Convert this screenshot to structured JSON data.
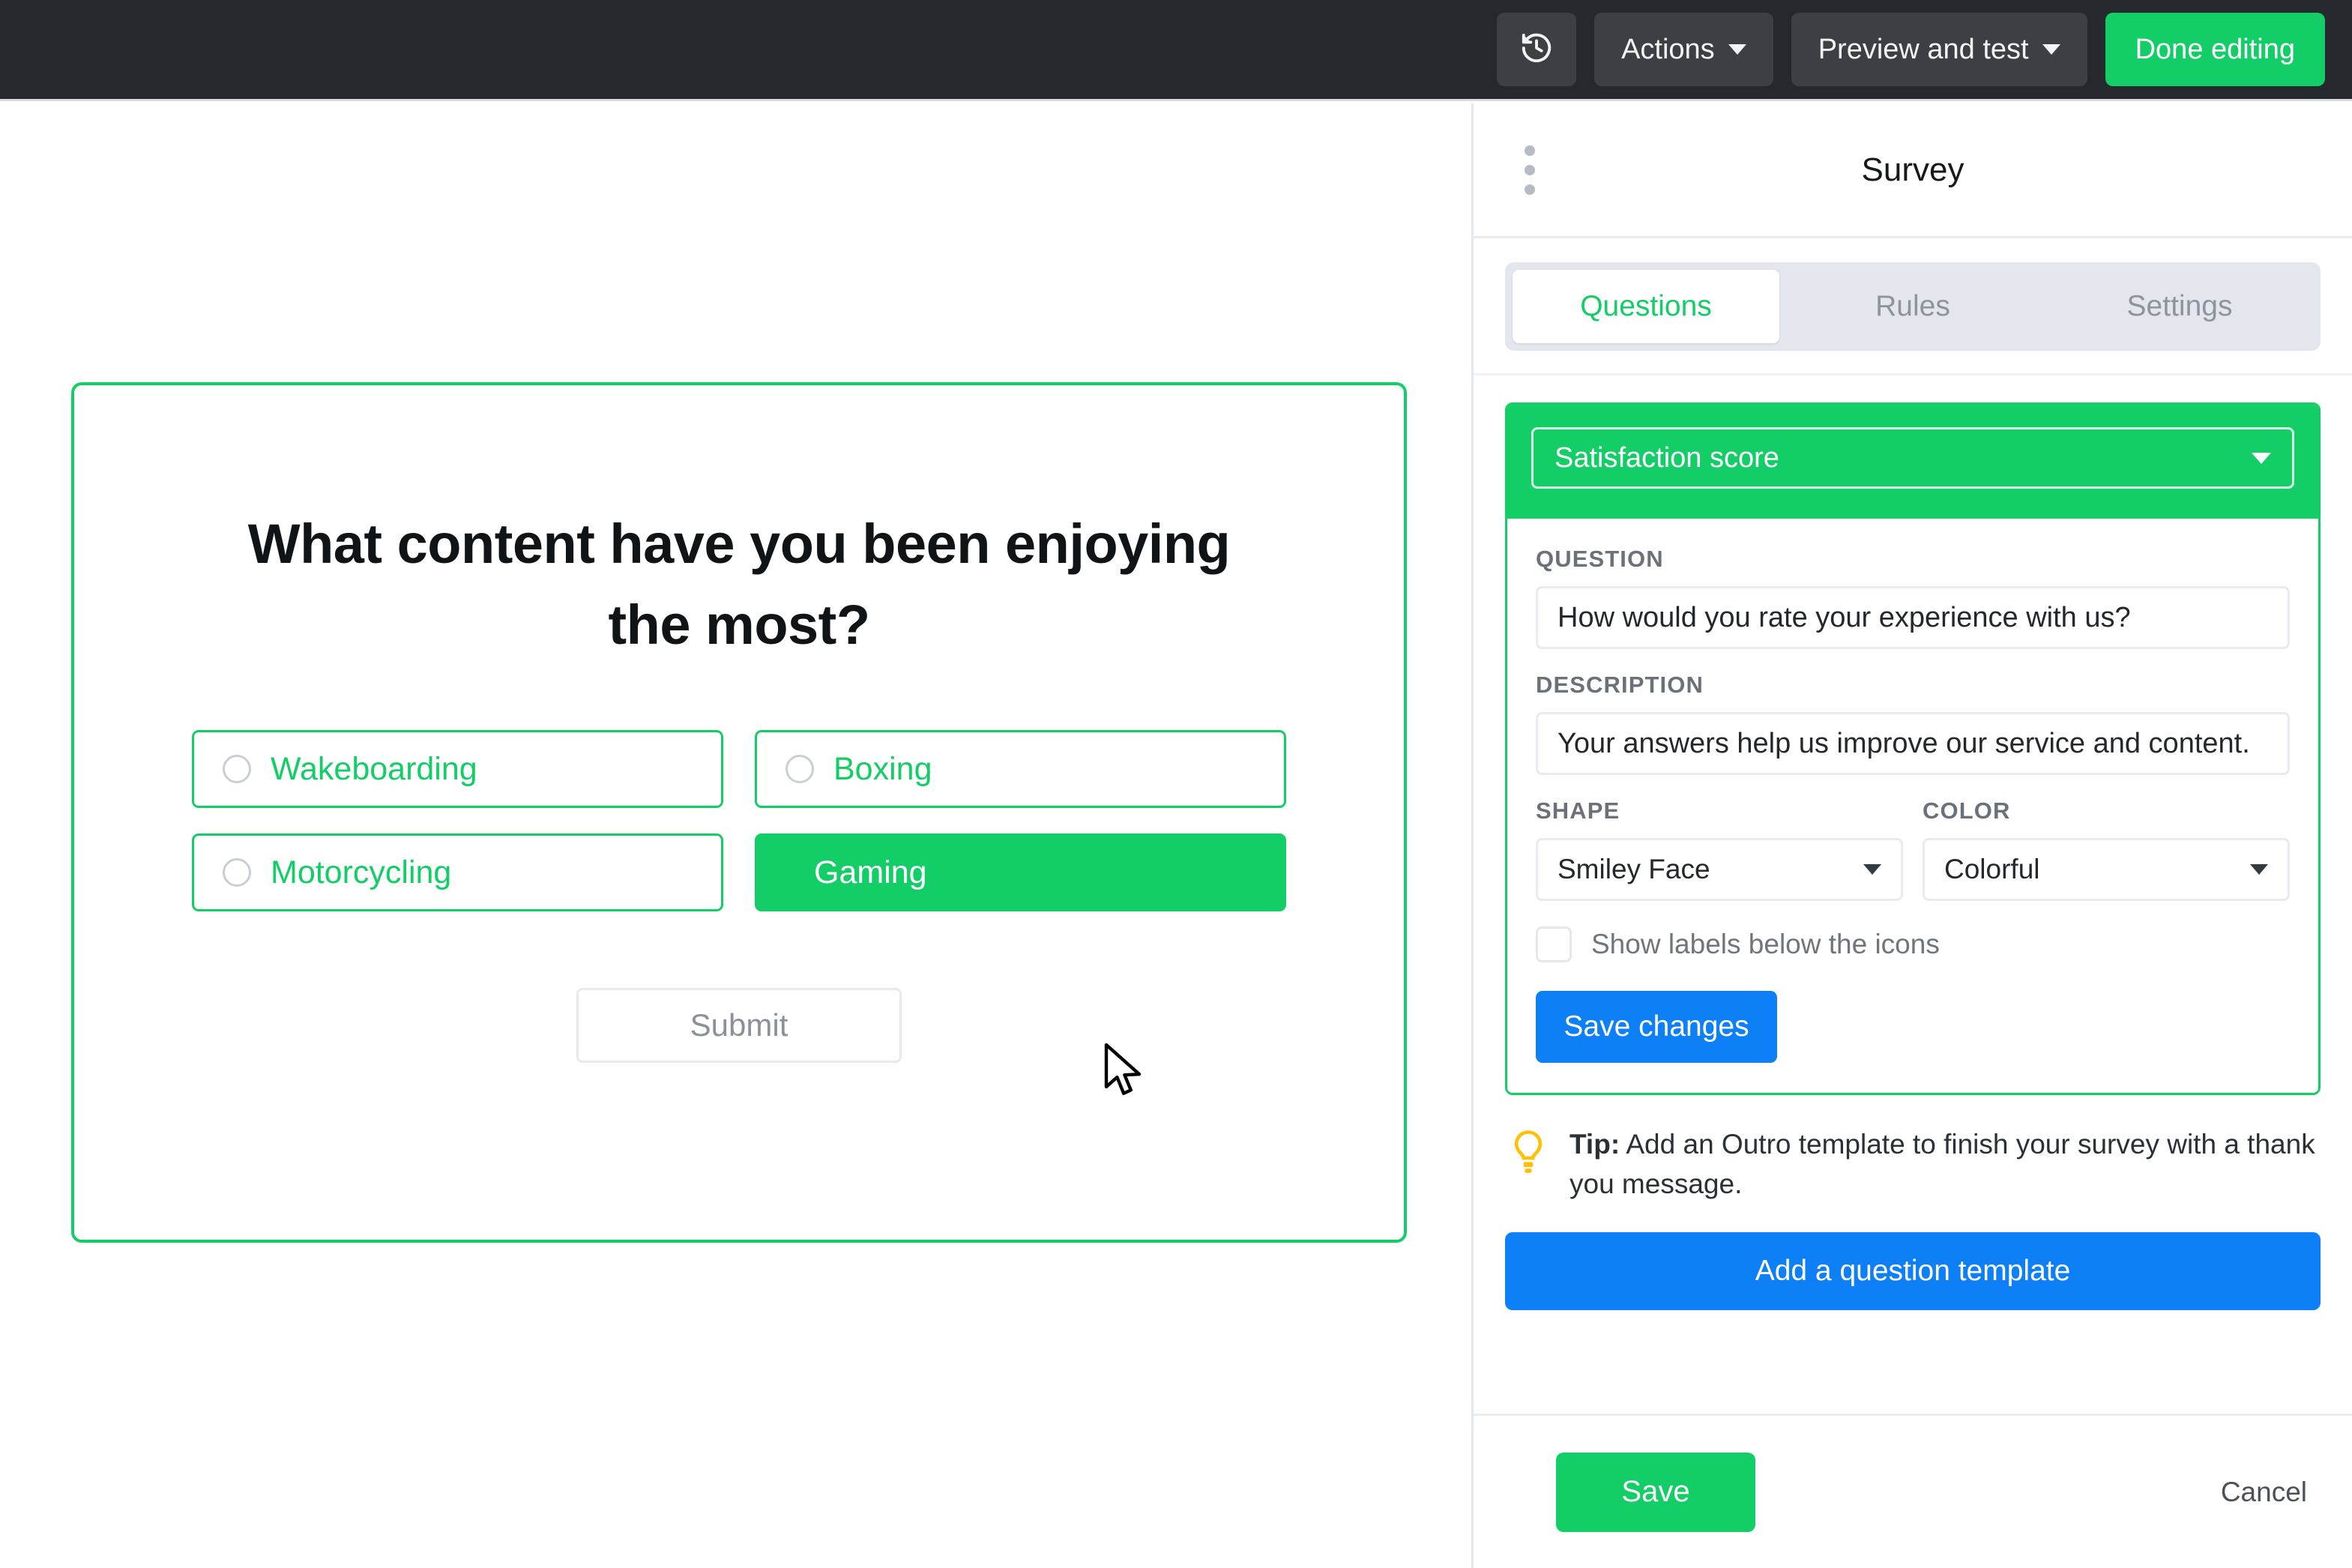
{
  "topbar": {
    "history_icon": "history-restore-icon",
    "actions_label": "Actions",
    "preview_label": "Preview and test",
    "done_label": "Done editing"
  },
  "preview": {
    "title": "What content have you been enjoying the most?",
    "options": [
      {
        "label": "Wakeboarding",
        "selected": false
      },
      {
        "label": "Boxing",
        "selected": false
      },
      {
        "label": "Motorcycling",
        "selected": false
      },
      {
        "label": "Gaming",
        "selected": true
      }
    ],
    "submit_label": "Submit"
  },
  "panel": {
    "title": "Survey",
    "kebab_icon": "more-vertical-icon",
    "tabs": [
      {
        "label": "Questions",
        "active": true
      },
      {
        "label": "Rules",
        "active": false
      },
      {
        "label": "Settings",
        "active": false
      }
    ],
    "question_card": {
      "type_value": "Satisfaction score",
      "question_label": "QUESTION",
      "question_value": "How would you rate your experience with us?",
      "description_label": "DESCRIPTION",
      "description_value": "Your answers help us improve our service and content.",
      "shape_label": "SHAPE",
      "shape_value": "Smiley Face",
      "color_label": "COLOR",
      "color_value": "Colorful",
      "show_labels_checkbox": "Show labels below the icons",
      "save_changes_label": "Save changes"
    },
    "tip": {
      "icon": "lightbulb-icon",
      "prefix": "Tip:",
      "text": " Add an Outro template to finish your survey with a thank you message."
    },
    "add_template_label": "Add a question template",
    "footer": {
      "save_label": "Save",
      "cancel_label": "Cancel"
    }
  },
  "colors": {
    "brand_green": "#13ce66",
    "accent_blue": "#0d7ff7",
    "topbar_dark": "#25292d",
    "tip_yellow": "#ffc107"
  }
}
